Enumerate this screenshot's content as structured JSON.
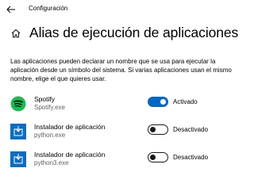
{
  "window": {
    "title": "Configuración"
  },
  "page": {
    "title": "Alias de ejecución de aplicaciones",
    "description": "Las aplicaciones pueden declarar un nombre que se usa para ejecutar la aplicación desde un símbolo del sistema. Si varias aplicaciones usan el mismo nombre, elige el que quieres usar."
  },
  "apps": [
    {
      "name": "Spotify",
      "file": "Spotify.exe",
      "enabled": true,
      "status_label": "Activado",
      "icon": "spotify-icon",
      "icon_color": "#1db954"
    },
    {
      "name": "Instalador de aplicación",
      "file": "python.exe",
      "enabled": false,
      "status_label": "Desactivado",
      "icon": "app-installer-icon",
      "icon_color": "#0f6cbd"
    },
    {
      "name": "Instalador de aplicación",
      "file": "python3.exe",
      "enabled": false,
      "status_label": "Desactivado",
      "icon": "app-installer-icon",
      "icon_color": "#0f6cbd"
    }
  ],
  "colors": {
    "accent": "#0067c0",
    "toggle_off_border": "#1a1a1a",
    "secondary_text": "#5f5f5f"
  }
}
